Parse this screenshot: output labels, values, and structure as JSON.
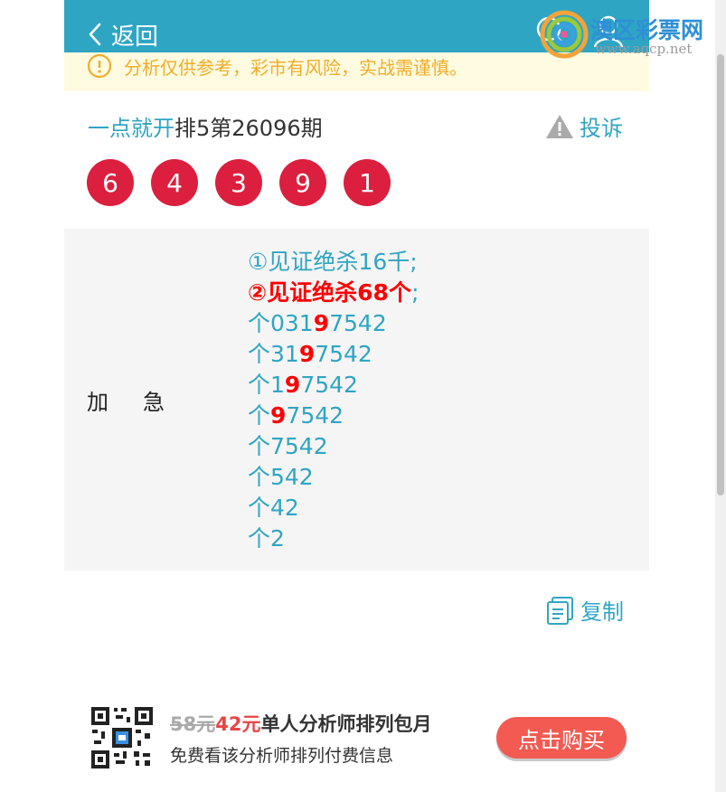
{
  "header": {
    "back_label": "返回"
  },
  "notice": {
    "text": "分析仅供参考，彩市有风险，实战需谨慎。"
  },
  "title": {
    "author": "一点就开",
    "issue": "排5第26096期"
  },
  "complain_label": "投诉",
  "balls": [
    "6",
    "4",
    "3",
    "9",
    "1"
  ],
  "content": {
    "label": "加急",
    "line1": "①见证绝杀16千;",
    "line2": "②见证绝杀68个",
    "line2_semi": ";",
    "rows": [
      {
        "pre": "个031",
        "hl": "9",
        "post": "7542"
      },
      {
        "pre": "个31",
        "hl": "9",
        "post": "7542"
      },
      {
        "pre": "个1",
        "hl": "9",
        "post": "7542"
      },
      {
        "pre": "个",
        "hl": "9",
        "post": "7542"
      },
      {
        "pre": "个7542",
        "hl": "",
        "post": ""
      },
      {
        "pre": "个542",
        "hl": "",
        "post": ""
      },
      {
        "pre": "个42",
        "hl": "",
        "post": ""
      },
      {
        "pre": "个2",
        "hl": "",
        "post": ""
      }
    ]
  },
  "copy_label": "复制",
  "promo": {
    "old_price": "58元",
    "new_price": "42元",
    "plan": "单人分析师排列包月",
    "desc": "免费看该分析师排列付费信息",
    "buy_label": "点击购买"
  },
  "watermark": {
    "name": "澳区彩票网",
    "url": "www.aqcp.net"
  },
  "colors": {
    "brand": "#2fa5c4",
    "ball": "#dc1f3e",
    "highlight": "#ff0000",
    "buy": "#f25a52",
    "notice_bg": "#fffbe0"
  }
}
